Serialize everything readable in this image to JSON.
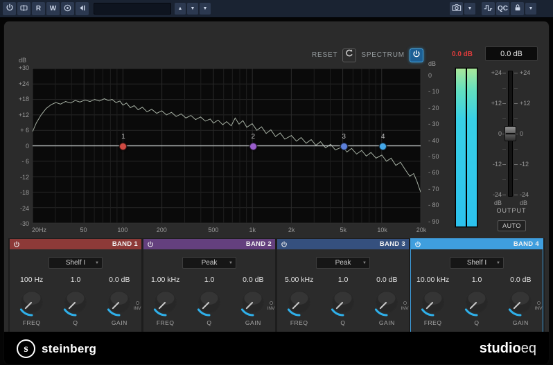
{
  "toolbar": {
    "read_label": "R",
    "write_label": "W",
    "qc_label": "QC"
  },
  "glyphs": {
    "up": "▲",
    "down": "▼"
  },
  "header": {
    "reset_label": "RESET",
    "spectrum_label": "SPECTRUM",
    "peak_readout": "0.0 dB",
    "output_readout": "0.0 dB"
  },
  "graph": {
    "unit_label": "dB",
    "y_ticks": [
      [
        "+30",
        30
      ],
      [
        "+24",
        24
      ],
      [
        "+18",
        18
      ],
      [
        "+12",
        12
      ],
      [
        "+ 6",
        6
      ],
      [
        "0",
        0
      ],
      [
        "- 6",
        -6
      ],
      [
        "-12",
        -12
      ],
      [
        "-18",
        -18
      ],
      [
        "-24",
        -24
      ],
      [
        "-30",
        -30
      ]
    ],
    "x_ticks": [
      [
        "20Hz",
        0
      ],
      [
        "50",
        0.1326
      ],
      [
        "100",
        0.233
      ],
      [
        "200",
        0.3333
      ],
      [
        "500",
        0.466
      ],
      [
        "1k",
        0.5663
      ],
      [
        "2k",
        0.6667
      ],
      [
        "5k",
        0.7993
      ],
      [
        "10k",
        0.8997
      ],
      [
        "20k",
        1
      ]
    ],
    "minor_gridlines": [
      0.0587,
      0.1003,
      0.159,
      0.1814,
      0.2007,
      0.2177,
      0.392,
      0.4337,
      0.4924,
      0.5147,
      0.534,
      0.5511,
      0.7254,
      0.767,
      0.8257,
      0.848,
      0.8674,
      0.8844
    ],
    "spectrum_scale_ticks": [
      "0",
      "- 10",
      "- 20",
      "- 30",
      "- 40",
      "- 50",
      "- 60",
      "- 70",
      "- 80",
      "- 90"
    ],
    "handles": [
      {
        "n": "1",
        "frac": 0.233,
        "db": 0,
        "color": "#d04a42"
      },
      {
        "n": "2",
        "frac": 0.5663,
        "db": 0,
        "color": "#9a5ecc"
      },
      {
        "n": "3",
        "frac": 0.7993,
        "db": 0,
        "color": "#5c80da"
      },
      {
        "n": "4",
        "frac": 0.8997,
        "db": 0,
        "color": "#44a8ea"
      }
    ],
    "spectrum_points": [
      [
        0.0,
        5.5
      ],
      [
        0.01,
        9.0
      ],
      [
        0.022,
        12.0
      ],
      [
        0.035,
        14.5
      ],
      [
        0.048,
        16.0
      ],
      [
        0.06,
        16.8
      ],
      [
        0.072,
        16.2
      ],
      [
        0.085,
        17.2
      ],
      [
        0.098,
        16.6
      ],
      [
        0.11,
        17.6
      ],
      [
        0.122,
        17.0
      ],
      [
        0.135,
        17.8
      ],
      [
        0.148,
        17.2
      ],
      [
        0.16,
        18.0
      ],
      [
        0.172,
        17.4
      ],
      [
        0.185,
        18.3
      ],
      [
        0.195,
        17.6
      ],
      [
        0.205,
        18.0
      ],
      [
        0.215,
        16.8
      ],
      [
        0.225,
        17.4
      ],
      [
        0.233,
        15.8
      ],
      [
        0.242,
        16.6
      ],
      [
        0.252,
        14.8
      ],
      [
        0.262,
        15.6
      ],
      [
        0.272,
        14.0
      ],
      [
        0.283,
        15.0
      ],
      [
        0.295,
        13.2
      ],
      [
        0.307,
        14.2
      ],
      [
        0.32,
        12.6
      ],
      [
        0.333,
        13.6
      ],
      [
        0.345,
        12.0
      ],
      [
        0.358,
        13.0
      ],
      [
        0.37,
        11.4
      ],
      [
        0.383,
        12.4
      ],
      [
        0.395,
        10.8
      ],
      [
        0.408,
        11.8
      ],
      [
        0.42,
        10.2
      ],
      [
        0.433,
        11.2
      ],
      [
        0.445,
        9.6
      ],
      [
        0.458,
        10.4
      ],
      [
        0.466,
        8.8
      ],
      [
        0.478,
        10.0
      ],
      [
        0.49,
        8.2
      ],
      [
        0.5,
        9.4
      ],
      [
        0.512,
        7.8
      ],
      [
        0.522,
        10.8
      ],
      [
        0.532,
        8.4
      ],
      [
        0.542,
        9.8
      ],
      [
        0.552,
        7.2
      ],
      [
        0.566,
        8.6
      ],
      [
        0.578,
        6.0
      ],
      [
        0.59,
        7.4
      ],
      [
        0.602,
        4.8
      ],
      [
        0.614,
        6.2
      ],
      [
        0.626,
        3.6
      ],
      [
        0.638,
        5.0
      ],
      [
        0.65,
        2.6
      ],
      [
        0.667,
        4.0
      ],
      [
        0.68,
        1.8
      ],
      [
        0.692,
        3.2
      ],
      [
        0.705,
        1.0
      ],
      [
        0.718,
        2.4
      ],
      [
        0.73,
        0.2
      ],
      [
        0.742,
        1.6
      ],
      [
        0.755,
        -0.8
      ],
      [
        0.768,
        0.6
      ],
      [
        0.78,
        -1.6
      ],
      [
        0.799,
        -0.4
      ],
      [
        0.81,
        -2.4
      ],
      [
        0.822,
        -1.0
      ],
      [
        0.835,
        -3.2
      ],
      [
        0.848,
        -1.8
      ],
      [
        0.86,
        -4.0
      ],
      [
        0.872,
        -2.6
      ],
      [
        0.885,
        -4.8
      ],
      [
        0.9,
        -3.6
      ],
      [
        0.912,
        -6.0
      ],
      [
        0.924,
        -4.8
      ],
      [
        0.936,
        -7.6
      ],
      [
        0.948,
        -6.4
      ],
      [
        0.96,
        -9.2
      ],
      [
        0.972,
        -11.8
      ],
      [
        0.982,
        -10.8
      ],
      [
        0.991,
        -14.0
      ],
      [
        1.0,
        -18.0
      ]
    ]
  },
  "output_section": {
    "fader_scale": [
      "+24",
      "+12",
      "0",
      "-12",
      "-24"
    ],
    "unit_label": "dB",
    "output_label": "OUTPUT",
    "auto_label": "AUTO",
    "fader_value_db": 0
  },
  "bands": [
    {
      "title": "BAND 1",
      "color": "#8d3a38",
      "type": "Shelf I",
      "freq": "100 Hz",
      "q": "1.0",
      "gain": "0.0 dB",
      "selected": false
    },
    {
      "title": "BAND 2",
      "color": "#64407e",
      "type": "Peak",
      "freq": "1.00 kHz",
      "q": "1.0",
      "gain": "0.0 dB",
      "selected": false
    },
    {
      "title": "BAND 3",
      "color": "#35507e",
      "type": "Peak",
      "freq": "5.00 kHz",
      "q": "1.0",
      "gain": "0.0 dB",
      "selected": false
    },
    {
      "title": "BAND 4",
      "color": "#3f9ede",
      "type": "Shelf I",
      "freq": "10.00 kHz",
      "q": "1.0",
      "gain": "0.0 dB",
      "selected": true
    }
  ],
  "knob_labels": {
    "freq": "FREQ",
    "q": "Q",
    "gain": "GAIN",
    "inv": "INV"
  },
  "footer": {
    "brand": "steinberg",
    "product_bold": "studio",
    "product_light": "eq"
  },
  "colors": {
    "accent": "#2fb0ea",
    "spectrum_line": "#c3cfc0",
    "eq_curve": "#c0c6c6",
    "meter_top": "#a8e89a",
    "meter_mid": "#38d0e6",
    "meter_bottom": "#2cc2ee",
    "readout_red": "#e03c3c",
    "selected_outline": "#3f9ede"
  }
}
